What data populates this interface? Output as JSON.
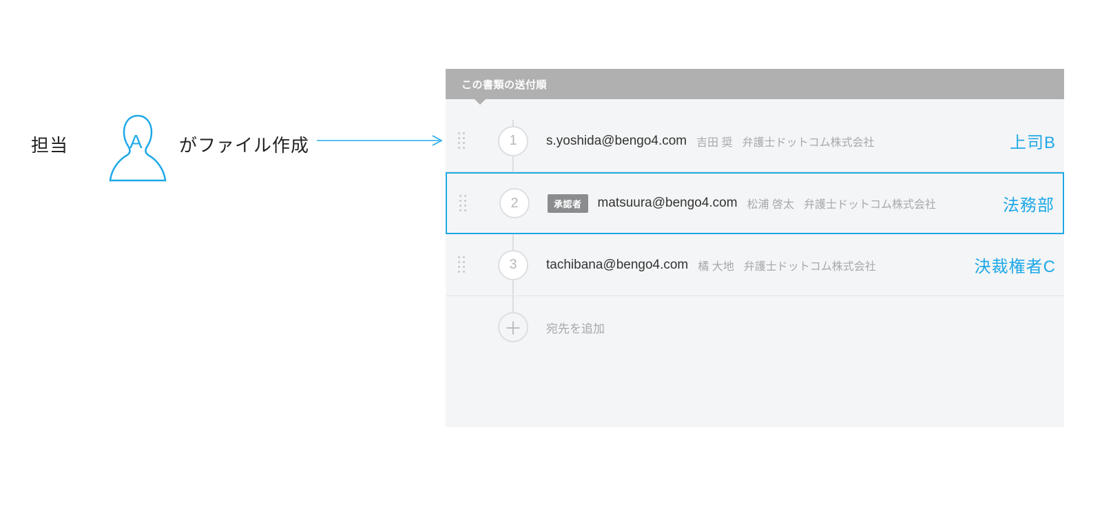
{
  "left": {
    "prefix": "担当",
    "person_letter": "A",
    "suffix": "がファイル作成"
  },
  "panel": {
    "title": "この書類の送付順",
    "add_label": "宛先を追加",
    "add_symbol": "＋",
    "rows": [
      {
        "num": "1",
        "approver_badge": "",
        "email": "s.yoshida@bengo4.com",
        "name": "吉田 奨",
        "company": "弁護士ドットコム株式会社",
        "annotation": "上司B"
      },
      {
        "num": "2",
        "approver_badge": "承認者",
        "email": "matsuura@bengo4.com",
        "name": "松浦 啓太",
        "company": "弁護士ドットコム株式会社",
        "annotation": "法務部"
      },
      {
        "num": "3",
        "approver_badge": "",
        "email": "tachibana@bengo4.com",
        "name": "橘 大地",
        "company": "弁護士ドットコム株式会社",
        "annotation": "決裁権者C"
      }
    ]
  }
}
